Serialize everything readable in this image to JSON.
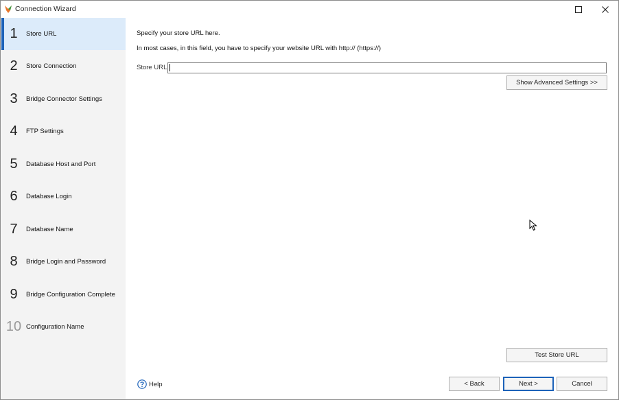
{
  "window": {
    "title": "Connection Wizard",
    "icons": {
      "app": "app-logo-icon",
      "maximize": "maximize-icon",
      "close": "close-icon"
    }
  },
  "steps": [
    {
      "num": "1",
      "label": "Store URL",
      "active": true
    },
    {
      "num": "2",
      "label": "Store Connection"
    },
    {
      "num": "3",
      "label": "Bridge Connector Settings"
    },
    {
      "num": "4",
      "label": "FTP Settings"
    },
    {
      "num": "5",
      "label": "Database Host and Port"
    },
    {
      "num": "6",
      "label": "Database Login"
    },
    {
      "num": "7",
      "label": "Database Name"
    },
    {
      "num": "8",
      "label": "Bridge Login and Password"
    },
    {
      "num": "9",
      "label": "Bridge Configuration Complete"
    },
    {
      "num": "10",
      "label": "Configuration Name",
      "dim": true
    }
  ],
  "main": {
    "intro": "Specify your store URL here.",
    "hint": "In most cases, in this field, you have to specify your website URL with http:// (https://)",
    "store_url_label": "Store URL",
    "store_url_value": "",
    "advanced_button": "Show Advanced Settings >>",
    "test_button": "Test Store URL"
  },
  "footer": {
    "help": "Help",
    "back": "< Back",
    "next": "Next >",
    "cancel": "Cancel"
  },
  "colors": {
    "active_step_bg": "#dcebfa",
    "active_step_bar": "#1c62b9",
    "sidebar_bg": "#f3f3f3",
    "help_icon": "#1c62b9"
  }
}
